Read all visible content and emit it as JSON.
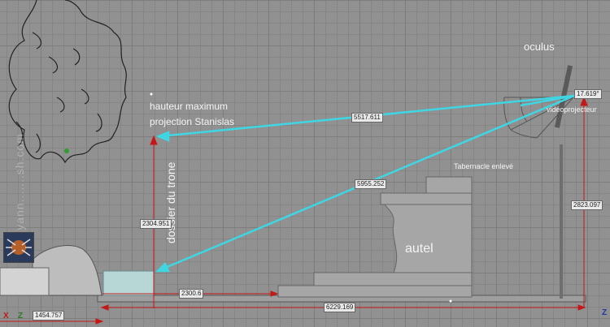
{
  "labels": {
    "oculus": "oculus",
    "hauteur_line1": "hauteur maximum",
    "hauteur_line2": "projection Stanislas",
    "dossier": "dossier du trone",
    "tabernacle": "Tabernacle enlevé",
    "autel": "autel",
    "videoprojecteur": "videoprojecteur",
    "watermark": "© yann.......sh.com"
  },
  "dimensions": {
    "d1": "5517.611",
    "d2": "5955.252",
    "d3": "2304.951",
    "d4": "2823.097",
    "d5": "2300.6",
    "d6": "6229.169",
    "d7": "1454.757",
    "d8": "17.619°"
  },
  "axes": {
    "x": "X",
    "z1": "Z",
    "z2": "Z"
  },
  "colors": {
    "cyan": "#3fd6e4",
    "red": "#c41818",
    "label": "#f4f4f4"
  }
}
